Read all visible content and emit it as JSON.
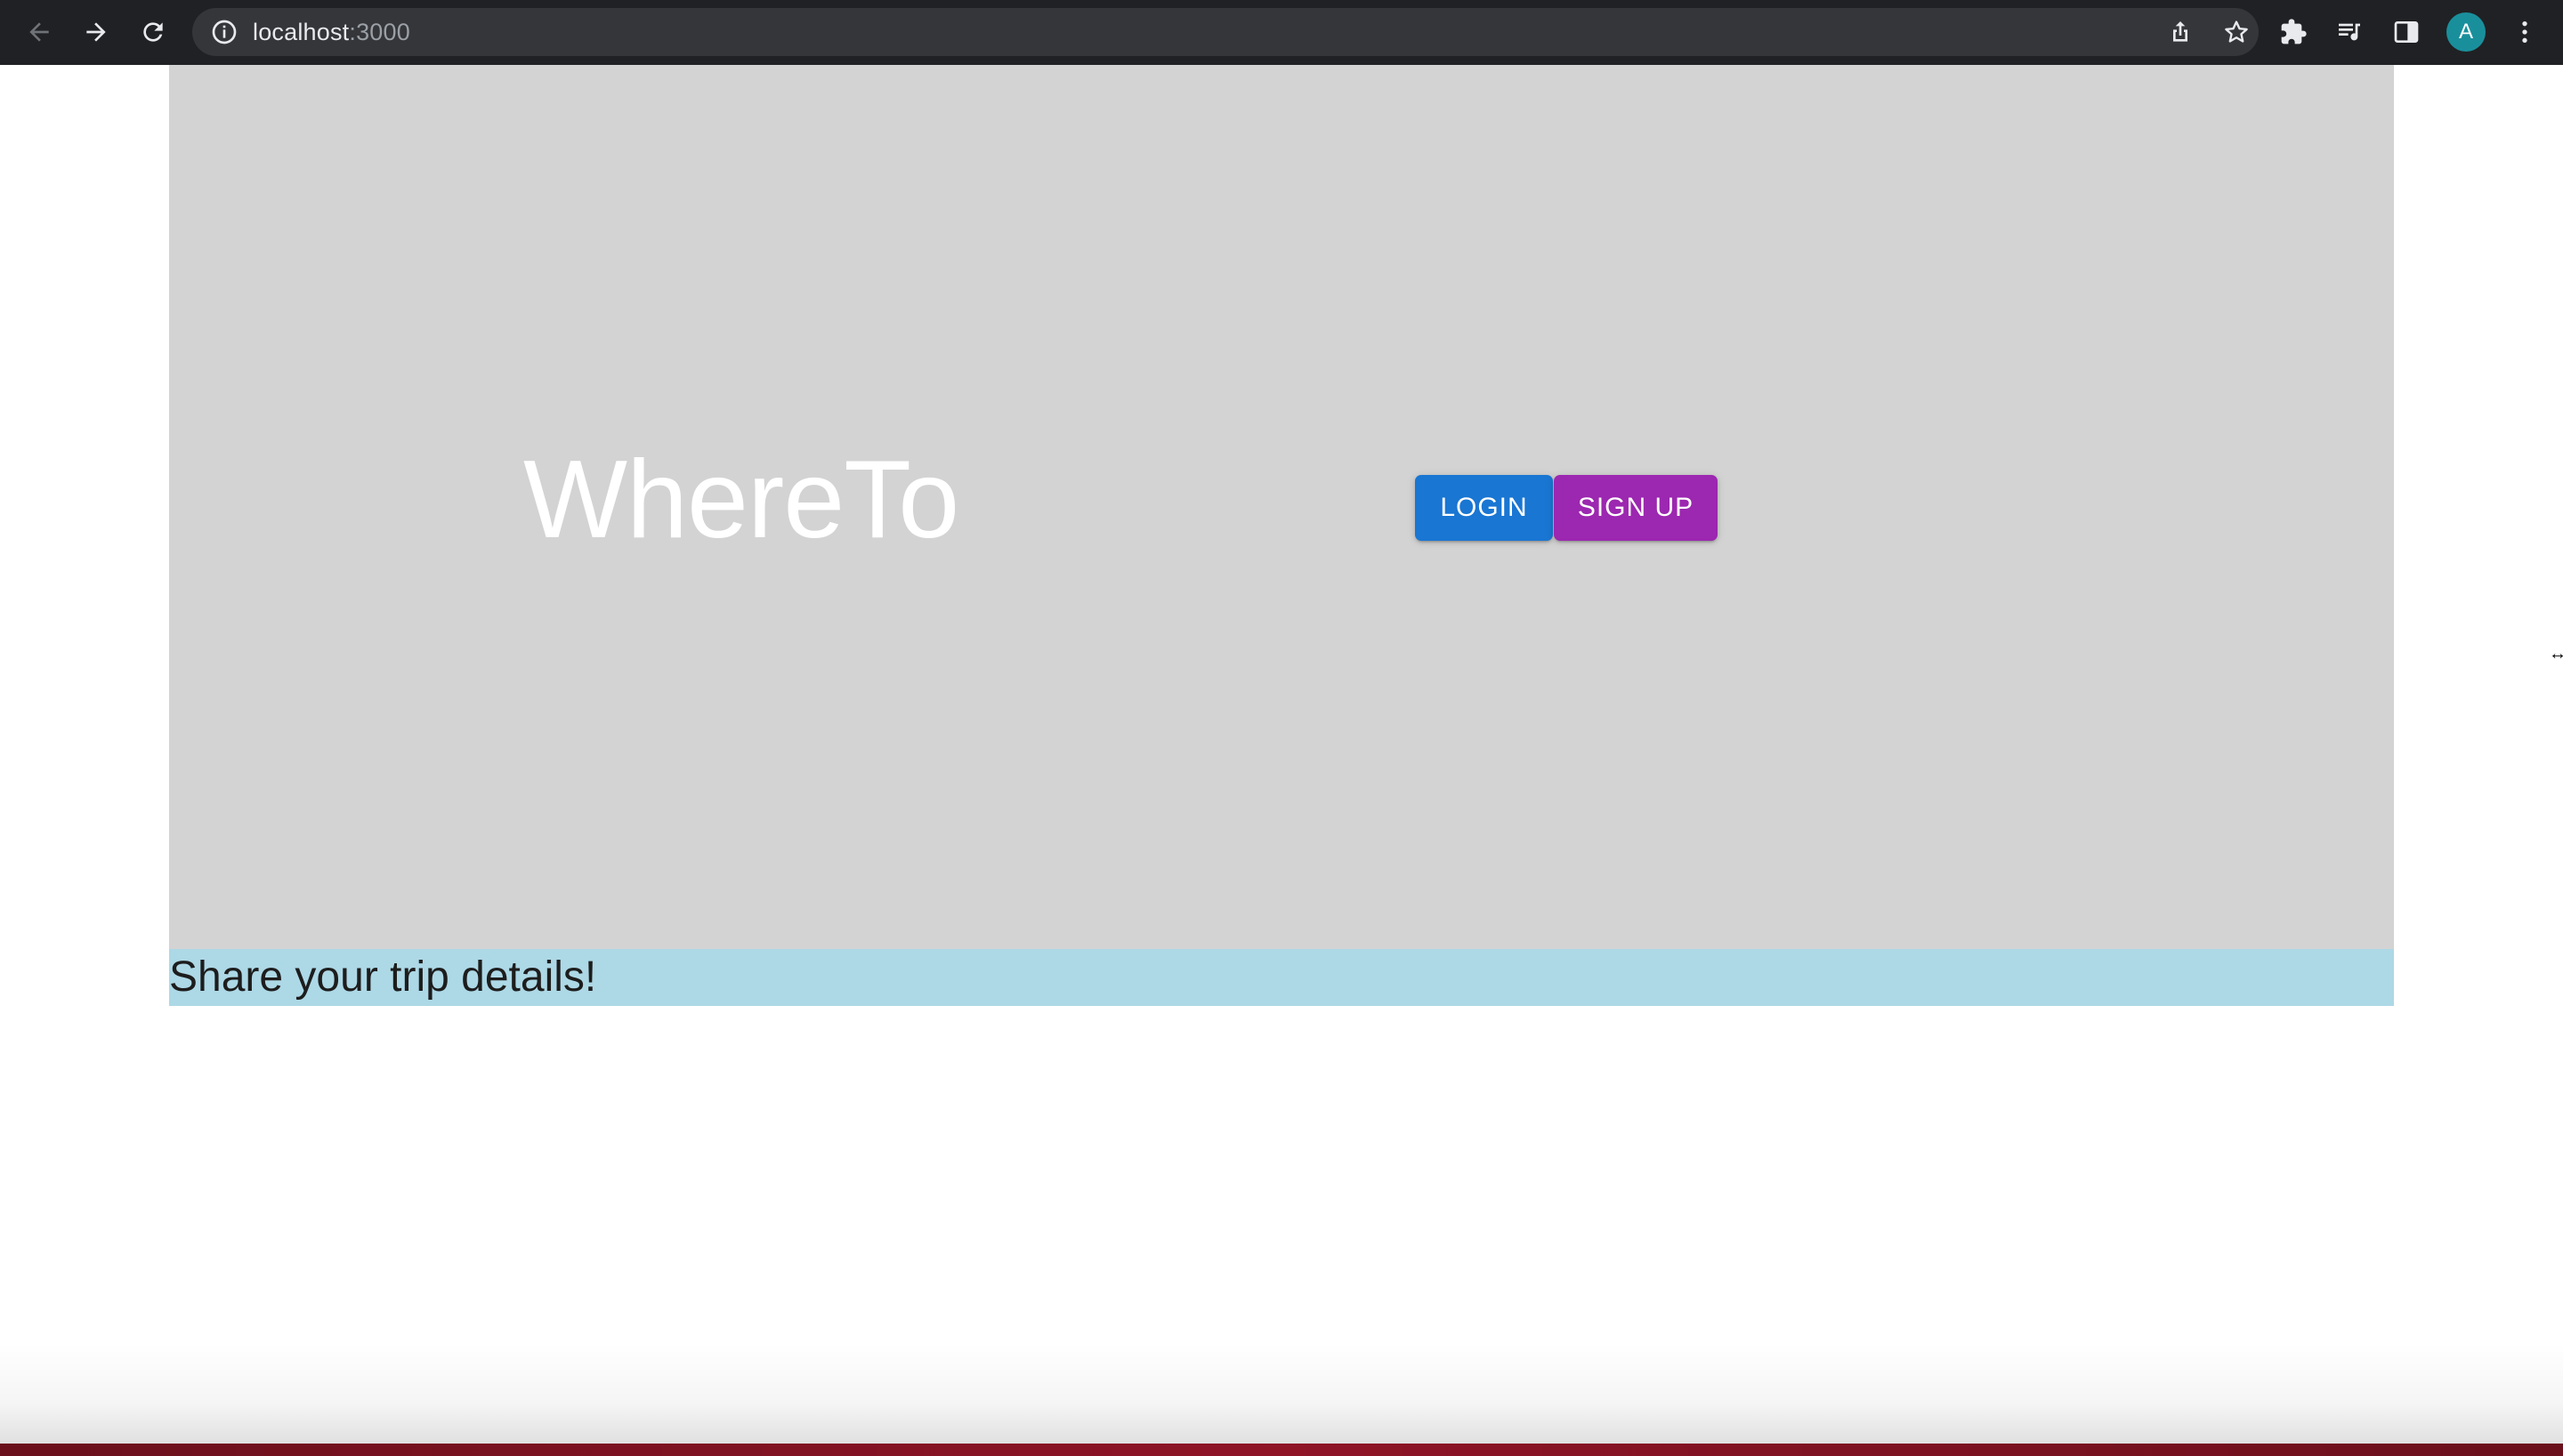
{
  "browser": {
    "url_host": "localhost",
    "url_port": ":3000",
    "profile_initial": "A",
    "icons": {
      "back": "arrow-left-icon",
      "forward": "arrow-right-icon",
      "reload": "reload-icon",
      "site_info": "info-icon",
      "share": "share-icon",
      "bookmark": "star-icon",
      "extensions": "puzzle-icon",
      "media": "media-queue-icon",
      "side_panel": "side-panel-icon",
      "menu": "kebab-menu-icon"
    }
  },
  "hero": {
    "brand": "WhereTo",
    "login_label": "LOGIN",
    "signup_label": "SIGN UP"
  },
  "tagline": "Share your trip details!",
  "colors": {
    "chrome_bg": "#202124",
    "omnibox_bg": "#35363a",
    "hero_bg": "#d3d3d3",
    "tagline_bg": "#add8e6",
    "login": "#1976d2",
    "signup": "#9c27b0",
    "avatar": "#1a8f9c"
  }
}
